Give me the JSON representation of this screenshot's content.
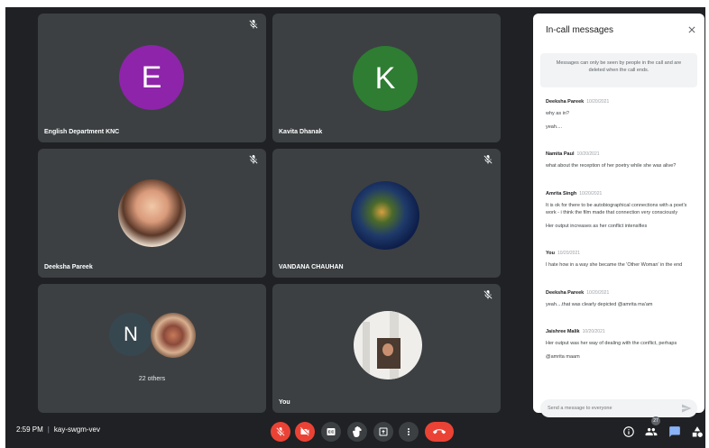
{
  "participants": [
    {
      "name": "English Department KNC",
      "initial": "E",
      "color": "#8e24aa"
    },
    {
      "name": "Kavita Dhanak",
      "initial": "K",
      "color": "#2e7d32"
    },
    {
      "name": "Deeksha Pareek"
    },
    {
      "name": "VANDANA CHAUHAN"
    },
    {
      "others_label": "22 others",
      "initial": "N",
      "color": "#37474f"
    },
    {
      "name": "You"
    }
  ],
  "panel": {
    "title": "In-call messages",
    "notice": "Messages can only be seen by people in the call and are deleted when the call ends.",
    "messages": [
      {
        "sender": "Deeksha Pareek",
        "time": "10/20/2021",
        "lines": [
          "why as in?",
          "yeah...."
        ]
      },
      {
        "sender": "Namita Paul",
        "time": "10/20/2021",
        "lines": [
          "what about the reception of her poetry while she was alive?"
        ]
      },
      {
        "sender": "Amrita Singh",
        "time": "10/20/2021",
        "lines": [
          "It is ok for there to be autobiographical connections with a poet's work - i think the film made that connection very consciously",
          "Her output increases as her conflict intensifies"
        ]
      },
      {
        "sender": "You",
        "time": "10/20/2021",
        "lines": [
          "I hate how in a way she became the 'Other Woman' in the end"
        ]
      },
      {
        "sender": "Deeksha Pareek",
        "time": "10/20/2021",
        "lines": [
          "yeah....that was clearly depicted @amrita ma'am"
        ]
      },
      {
        "sender": "Jaishree Malik",
        "time": "10/20/2021",
        "lines": [
          "Her output was her way of dealing with the conflict, perhaps",
          "@amrita maam"
        ]
      }
    ],
    "compose_placeholder": "Send a message to everyone"
  },
  "bottom": {
    "time": "2:59 PM",
    "separator": "|",
    "meeting_code": "kay-swgm-vev",
    "people_count": "27"
  },
  "icons": {
    "mic_off": "mic-off-icon",
    "cam_off": "camera-off-icon",
    "captions": "captions-icon",
    "hand": "raise-hand-icon",
    "present": "present-icon",
    "more": "more-vert-icon",
    "leave": "call-end-icon",
    "info": "info-icon",
    "people": "people-icon",
    "chat": "chat-icon",
    "activities": "activities-icon"
  },
  "colors": {
    "bg": "#202124",
    "tile": "#3c4043",
    "red": "#ea4335",
    "chat_active": "#8ab4f8"
  }
}
